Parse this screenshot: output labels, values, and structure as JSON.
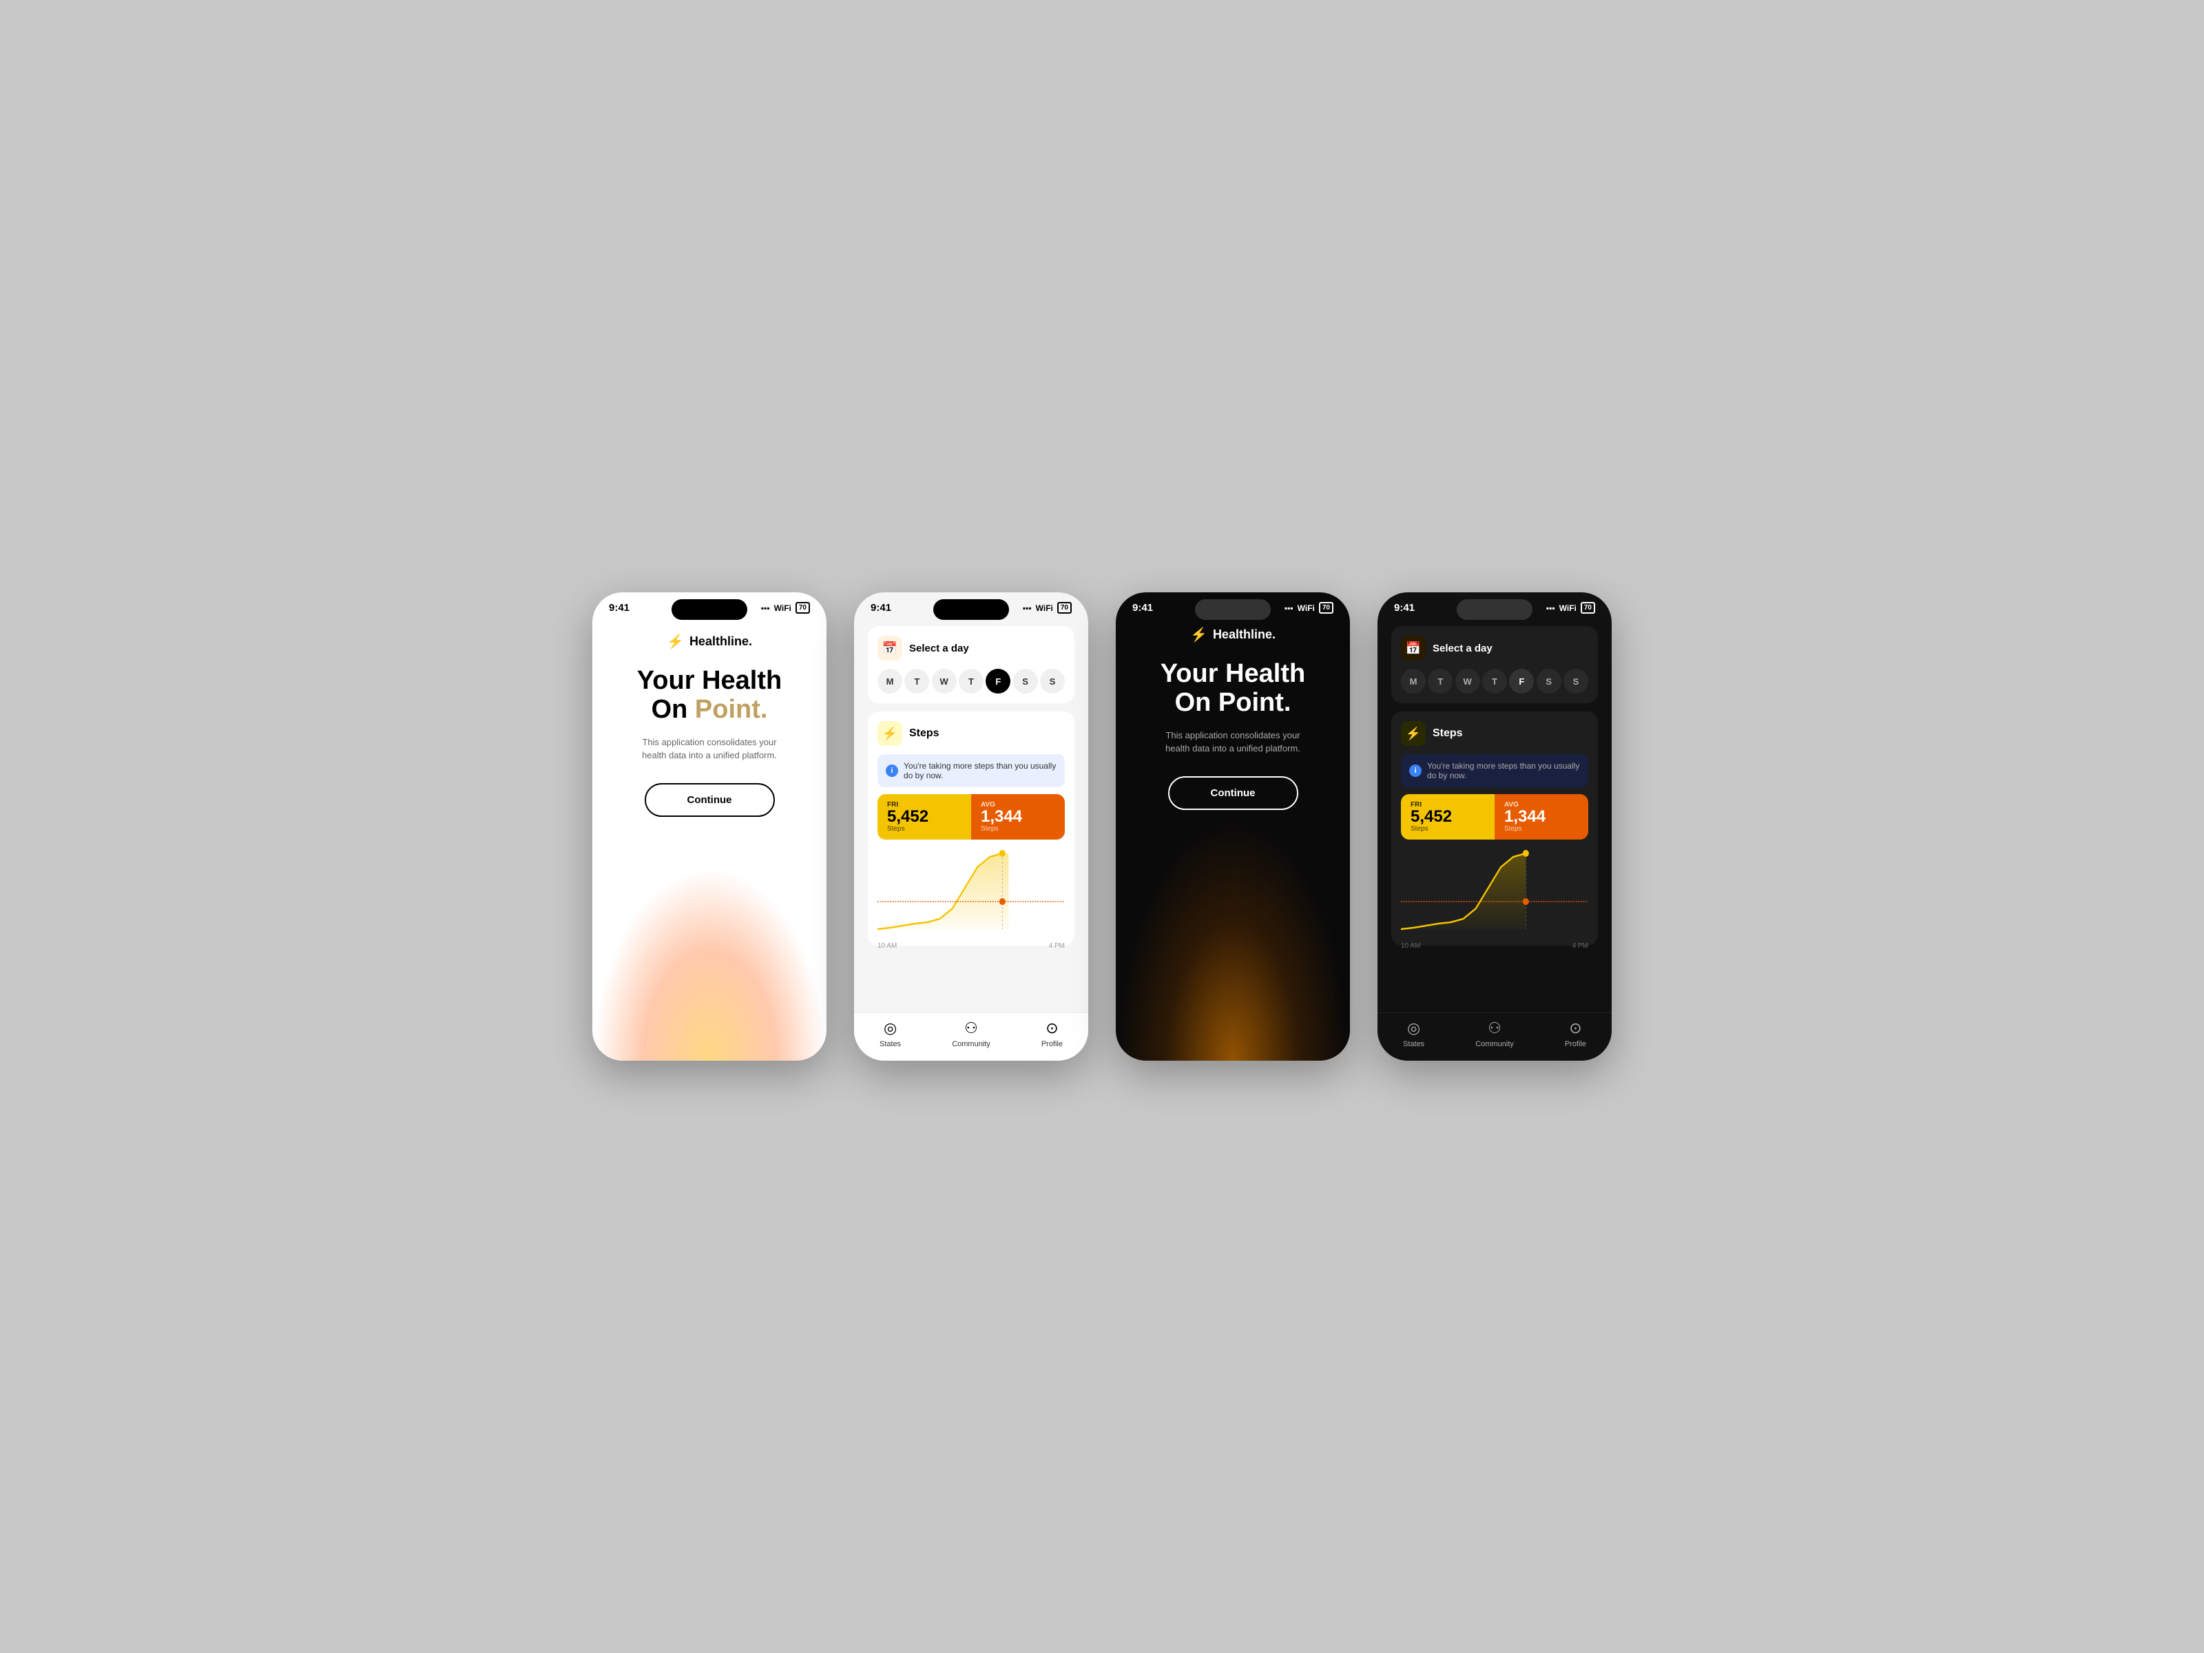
{
  "colors": {
    "accent_yellow": "#f5c400",
    "accent_orange": "#e85c00",
    "dark_bg": "#111111",
    "light_bg": "#f5f5f5",
    "card_dark": "#1e1e1e"
  },
  "phone1": {
    "status_time": "9:41",
    "brand_name": "Healthline.",
    "hero_title_line1": "Your Health",
    "hero_title_line2": "On ",
    "hero_title_accent": "Point.",
    "subtitle": "This application consolidates your health data into a unified platform.",
    "button_label": "Continue"
  },
  "phone2": {
    "status_time": "9:41",
    "select_day_label": "Select a day",
    "days": [
      "M",
      "T",
      "W",
      "T",
      "F",
      "S",
      "S"
    ],
    "active_day_index": 4,
    "steps_title": "Steps",
    "steps_info": "You're taking more steps than you usually do by now.",
    "fri_label": "FRI",
    "fri_steps": "5,452",
    "fri_unit": "Steps",
    "avg_label": "AVG",
    "avg_steps": "1,344",
    "avg_unit": "Steps",
    "time_start": "10 AM",
    "time_end": "4 PM",
    "nav": {
      "states_label": "States",
      "community_label": "Community",
      "profile_label": "Profile"
    }
  },
  "phone3": {
    "status_time": "9:41",
    "brand_name": "Healthline.",
    "hero_title_line1": "Your Health",
    "hero_title_line2": "On ",
    "hero_title_accent": "Point.",
    "subtitle": "This application consolidates your health data into a unified platform.",
    "button_label": "Continue"
  },
  "phone4": {
    "status_time": "9:41",
    "select_day_label": "Select a day",
    "days": [
      "M",
      "T",
      "W",
      "T",
      "F",
      "S",
      "S"
    ],
    "active_day_index": 4,
    "steps_title": "Steps",
    "steps_info": "You're taking more steps than you usually do by now.",
    "fri_label": "FRI",
    "fri_steps": "5,452",
    "fri_unit": "Steps",
    "avg_label": "AVG",
    "avg_steps": "1,344",
    "avg_unit": "Steps",
    "time_start": "10 AM",
    "time_end": "4 PM",
    "nav": {
      "states_label": "States",
      "community_label": "Community",
      "profile_label": "Profile"
    }
  }
}
